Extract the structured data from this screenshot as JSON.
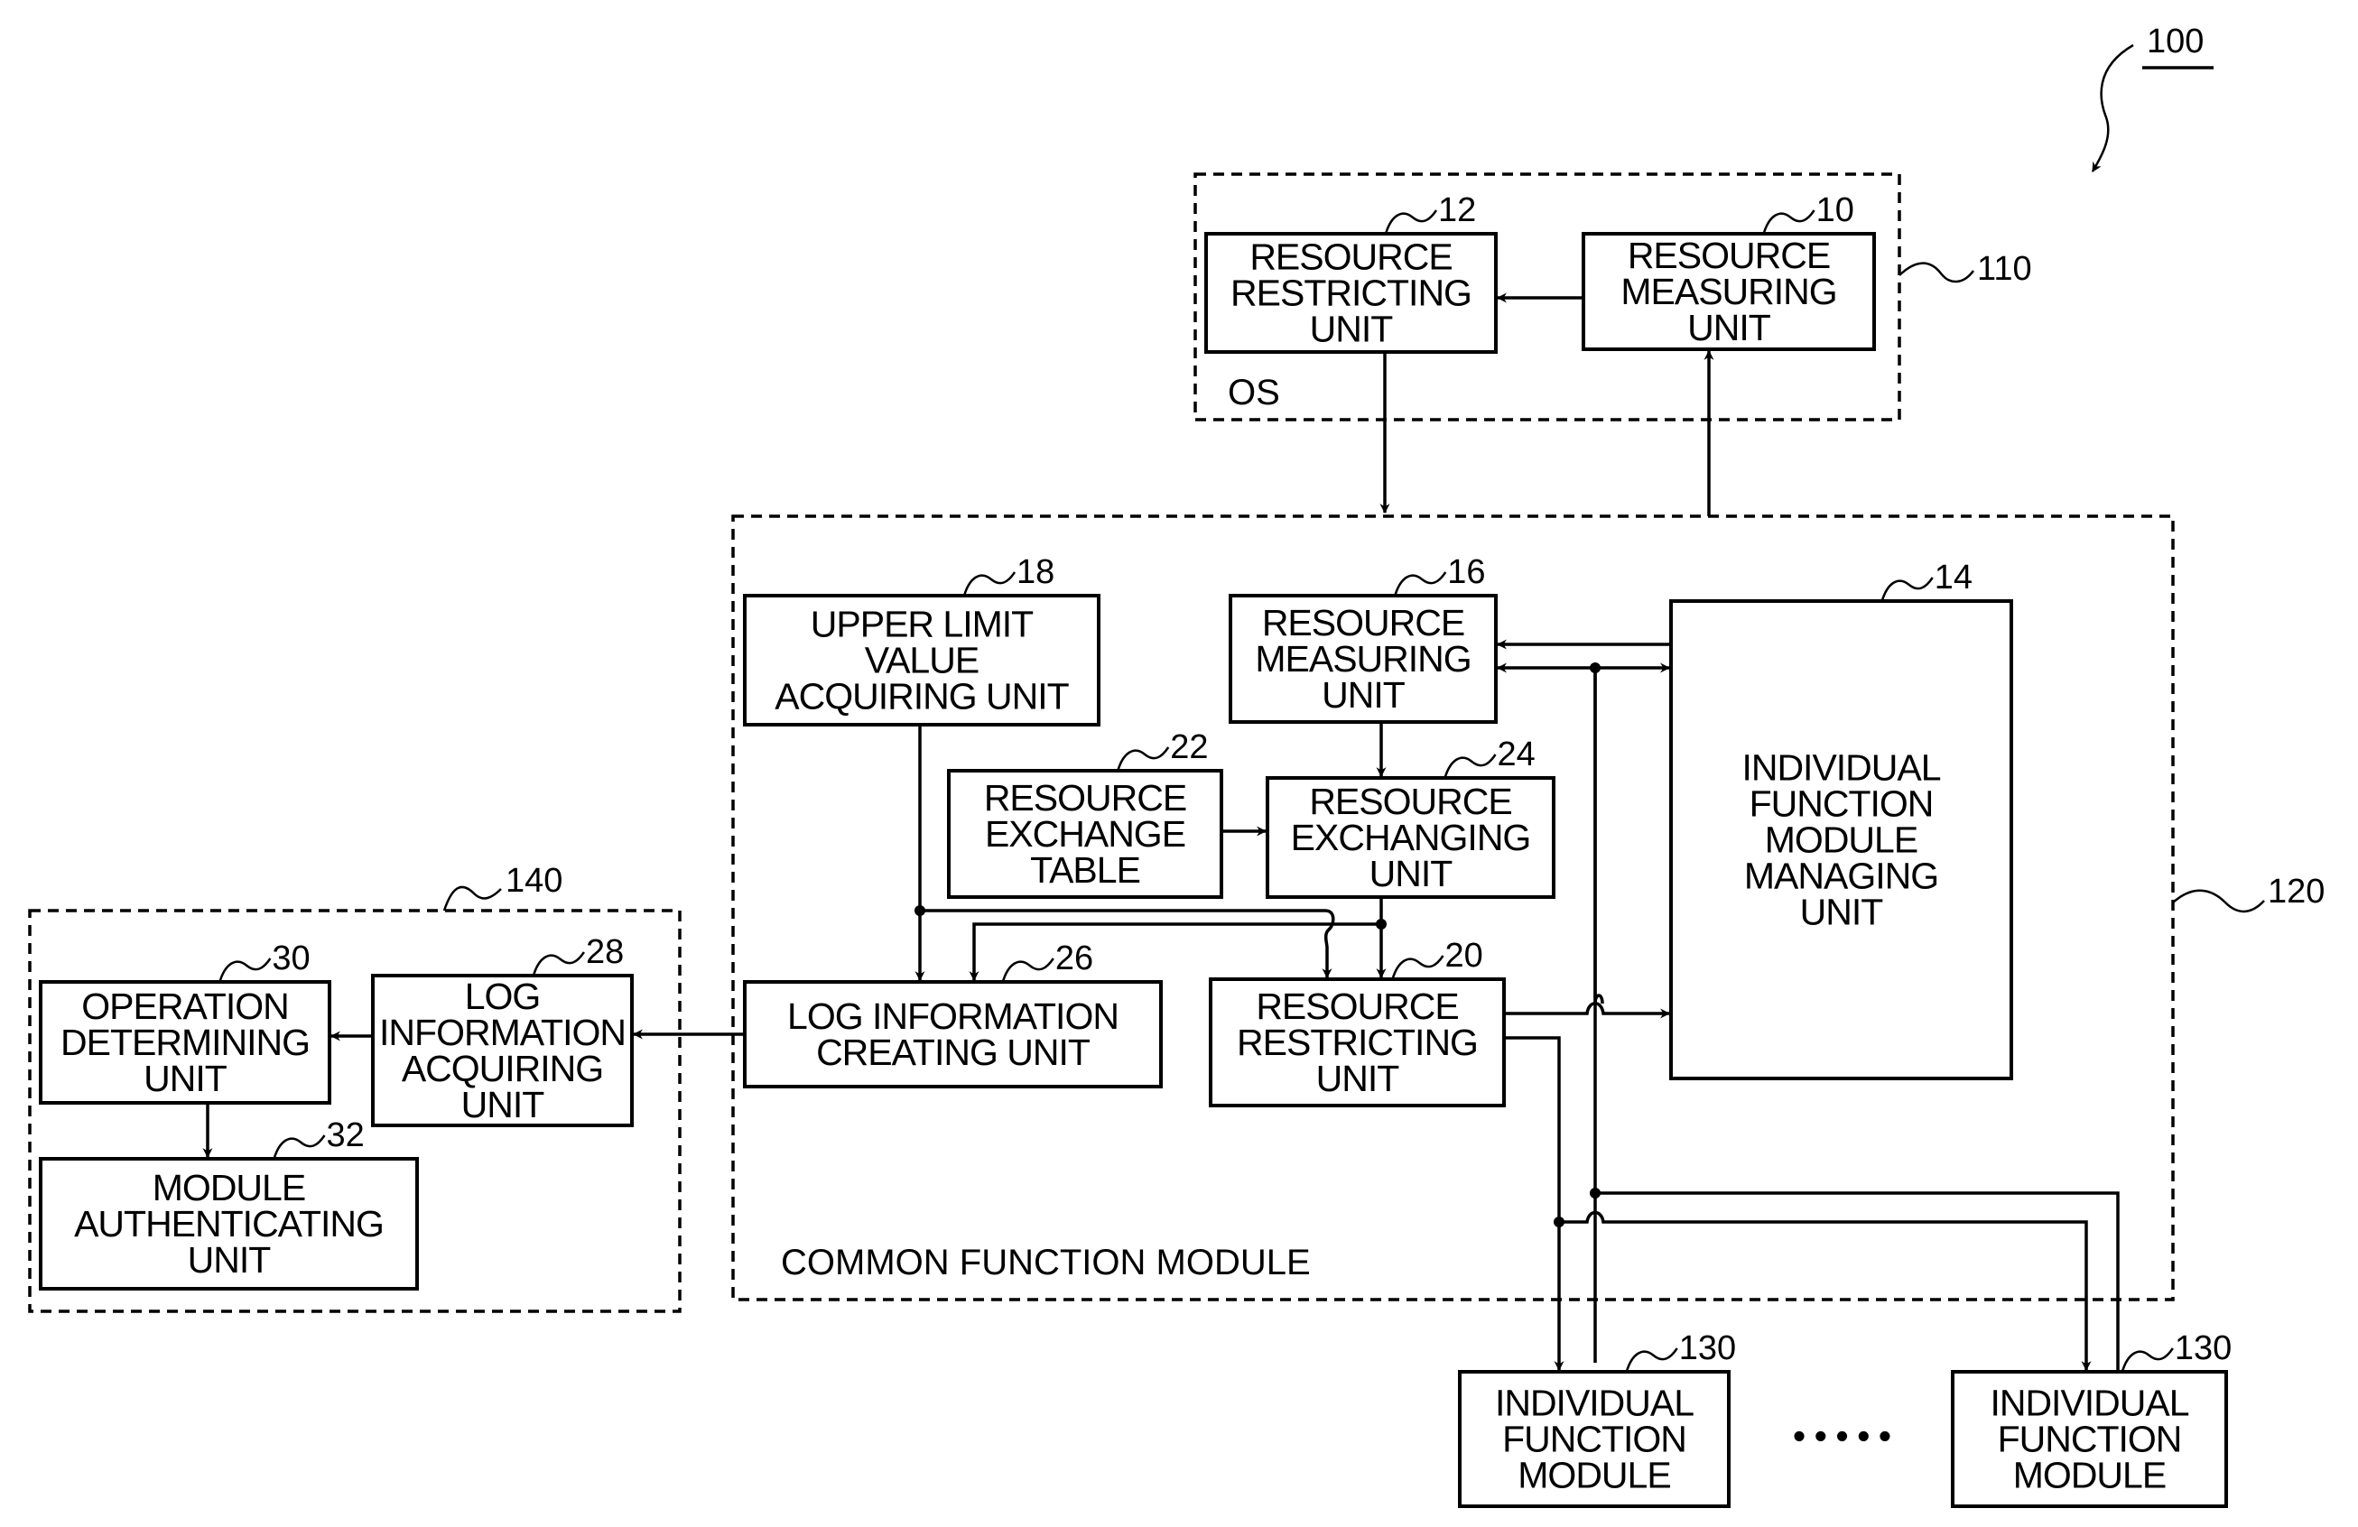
{
  "figure": {
    "reference": "100",
    "groups": {
      "os": {
        "ref": "110",
        "caption": "OS"
      },
      "common": {
        "ref": "120",
        "caption": "COMMON FUNCTION MODULE"
      },
      "external": {
        "ref": "140"
      }
    },
    "blocks": {
      "b12": {
        "ref": "12",
        "lines": [
          "RESOURCE",
          "RESTRICTING",
          "UNIT"
        ]
      },
      "b10": {
        "ref": "10",
        "lines": [
          "RESOURCE",
          "MEASURING",
          "UNIT"
        ]
      },
      "b18": {
        "ref": "18",
        "lines": [
          "UPPER LIMIT",
          "VALUE",
          "ACQUIRING UNIT"
        ]
      },
      "b16": {
        "ref": "16",
        "lines": [
          "RESOURCE",
          "MEASURING",
          "UNIT"
        ]
      },
      "b14": {
        "ref": "14",
        "lines": [
          "INDIVIDUAL",
          "FUNCTION",
          "MODULE",
          "MANAGING",
          "UNIT"
        ]
      },
      "b22": {
        "ref": "22",
        "lines": [
          "RESOURCE",
          "EXCHANGE",
          "TABLE"
        ]
      },
      "b24": {
        "ref": "24",
        "lines": [
          "RESOURCE",
          "EXCHANGING",
          "UNIT"
        ]
      },
      "b26": {
        "ref": "26",
        "lines": [
          "LOG INFORMATION",
          "CREATING UNIT"
        ]
      },
      "b20": {
        "ref": "20",
        "lines": [
          "RESOURCE",
          "RESTRICTING",
          "UNIT"
        ]
      },
      "b30": {
        "ref": "30",
        "lines": [
          "OPERATION",
          "DETERMINING",
          "UNIT"
        ]
      },
      "b28": {
        "ref": "28",
        "lines": [
          "LOG",
          "INFORMATION",
          "ACQUIRING",
          "UNIT"
        ]
      },
      "b32": {
        "ref": "32",
        "lines": [
          "MODULE",
          "AUTHENTICATING",
          "UNIT"
        ]
      },
      "b130a": {
        "ref": "130",
        "lines": [
          "INDIVIDUAL",
          "FUNCTION",
          "MODULE"
        ]
      },
      "b130b": {
        "ref": "130",
        "lines": [
          "INDIVIDUAL",
          "FUNCTION",
          "MODULE"
        ]
      }
    },
    "ellipsis": "• • • • •"
  }
}
